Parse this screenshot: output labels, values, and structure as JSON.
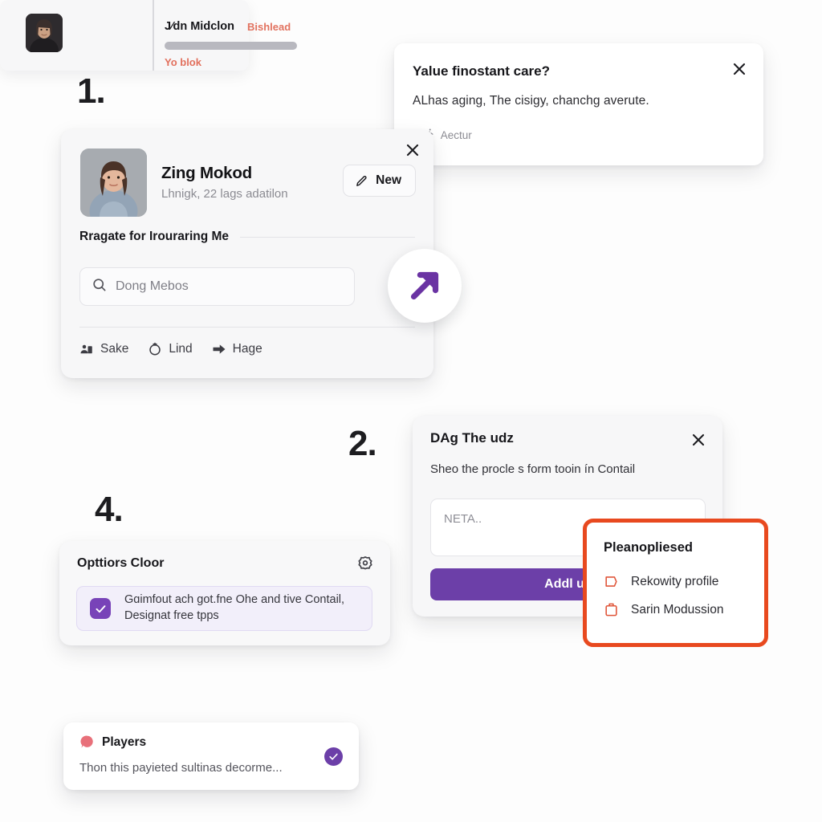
{
  "steps": [
    {
      "label": "1."
    },
    {
      "label": "2."
    },
    {
      "label": "4."
    }
  ],
  "banner_card": {
    "title": "Yalue finostant care?",
    "body": "ALhas aging, The cisigy, chanchg averute.",
    "footer_prefix": ".",
    "footer_label": "Aectur",
    "footer_icon": "person-running-icon",
    "close_icon": "close-icon"
  },
  "profile_card": {
    "close_icon": "close-icon",
    "avatar_icon": "user-photo",
    "name": "Zing Mokod",
    "subtitle": "Lhnigk, 22 lags adatilon",
    "new_button": {
      "label": "New",
      "icon": "pencil-icon"
    },
    "section_title": "Rragate for Irouraring Me",
    "search": {
      "value": "Dong Mebos",
      "icon": "search-icon"
    },
    "footer_actions": [
      {
        "label": "Sake",
        "icon": "people-icon"
      },
      {
        "label": "Lind",
        "icon": "circle-arrow-icon"
      },
      {
        "label": "Hage",
        "icon": "arrow-right-icon"
      }
    ]
  },
  "arrow_badge": {
    "icon": "arrow-up-right-icon"
  },
  "form_card": {
    "title": "DAg The udz",
    "subtitle": "Sheo the procle s form tooin ín Contail",
    "input_placeholder": "NETA..",
    "submit_label": "Addl us",
    "close_icon": "close-icon"
  },
  "orange_popup": {
    "title": "Pleanopliesed",
    "items": [
      {
        "label": "Rekowity profile",
        "icon": "tag-icon"
      },
      {
        "label": "Sarin Modussion",
        "icon": "clipboard-icon"
      }
    ]
  },
  "options_card": {
    "title": "Opttiors Cloor",
    "gear_icon": "gear-icon",
    "option": {
      "checked": true,
      "line1": "Gɑimfout ach got.fne Ohe and tive Contail,",
      "line2": "Designat free tpps",
      "check_icon": "check-icon"
    }
  },
  "list_card": {
    "avatar_icon": "user-photo",
    "name": "J⁄dn Midclon",
    "badge": "Bishlead",
    "footer": "Yo blok"
  },
  "toast": {
    "icon": "alert-dot-icon",
    "title": "Players",
    "body": "Thon this payieted sultinas decorme...",
    "check_icon": "check-circle-icon"
  },
  "colors": {
    "purple": "#6c3fa8",
    "orange": "#e8491f",
    "coral": "#e2705d",
    "page_bg": "#fdfdfd"
  }
}
